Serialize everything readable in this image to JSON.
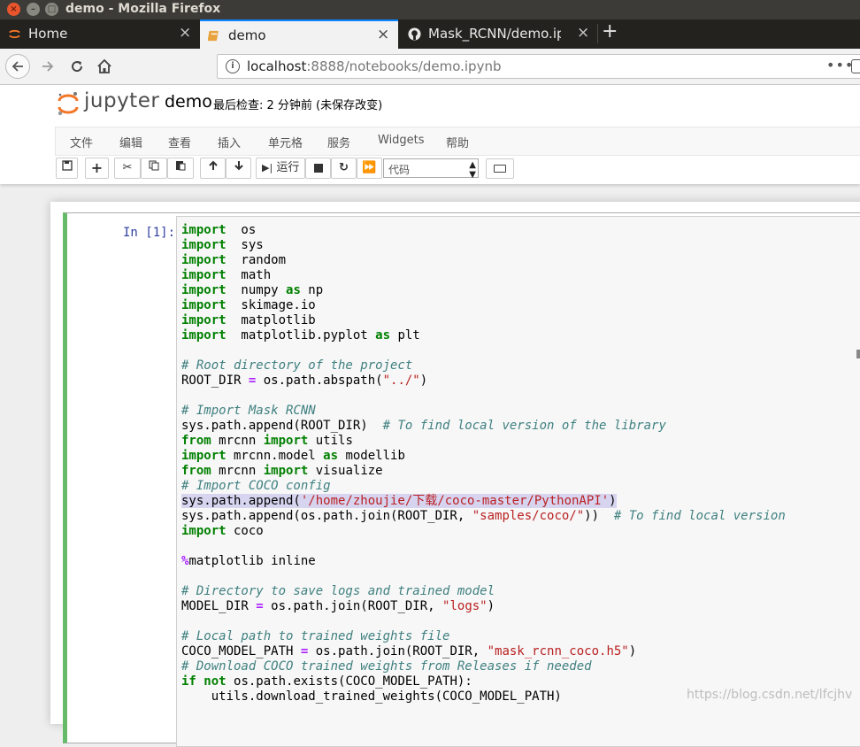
{
  "window": {
    "title": "demo - Mozilla Firefox"
  },
  "tabs": [
    {
      "label": "Home",
      "icon": "jupyter-icon"
    },
    {
      "label": "demo",
      "icon": "notebook-icon"
    },
    {
      "label": "Mask_RCNN/demo.ipynb",
      "icon": "github-icon"
    }
  ],
  "url": {
    "host": "localhost",
    "path": ":8888/notebooks/demo.ipynb",
    "more": "•••"
  },
  "jupyter": {
    "logo_text": "jupyter",
    "notebook_name": "demo",
    "checkpoint": "最后检查: 2 分钟前  (未保存改变)"
  },
  "menu": [
    "文件",
    "编辑",
    "查看",
    "插入",
    "单元格",
    "服务",
    "Widgets",
    "帮助"
  ],
  "toolbar": {
    "run_label": "运行",
    "cell_type": "代码"
  },
  "cell": {
    "prompt": "In [1]:",
    "lines": [
      [
        [
          "kw",
          "import"
        ],
        [
          "",
          "  os"
        ]
      ],
      [
        [
          "kw",
          "import"
        ],
        [
          "",
          "  sys"
        ]
      ],
      [
        [
          "kw",
          "import"
        ],
        [
          "",
          "  random"
        ]
      ],
      [
        [
          "kw",
          "import"
        ],
        [
          "",
          "  math"
        ]
      ],
      [
        [
          "kw",
          "import"
        ],
        [
          "",
          "  numpy "
        ],
        [
          "kw",
          "as"
        ],
        [
          "",
          " np"
        ]
      ],
      [
        [
          "kw",
          "import"
        ],
        [
          "",
          "  skimage.io"
        ]
      ],
      [
        [
          "kw",
          "import"
        ],
        [
          "",
          "  matplotlib"
        ]
      ],
      [
        [
          "kw",
          "import"
        ],
        [
          "",
          "  matplotlib.pyplot "
        ],
        [
          "kw",
          "as"
        ],
        [
          "",
          " plt"
        ]
      ],
      [],
      [
        [
          "cm",
          "# Root directory of the project"
        ]
      ],
      [
        [
          "",
          "ROOT_DIR "
        ],
        [
          "op",
          "="
        ],
        [
          "",
          " os.path.abspath("
        ],
        [
          "st",
          "\"../\""
        ],
        [
          "",
          ")"
        ]
      ],
      [],
      [
        [
          "cm",
          "# Import Mask RCNN"
        ]
      ],
      [
        [
          "",
          "sys.path.append(ROOT_DIR)  "
        ],
        [
          "cm",
          "# To find local version of the library"
        ]
      ],
      [
        [
          "kw",
          "from"
        ],
        [
          "",
          " mrcnn "
        ],
        [
          "kw",
          "import"
        ],
        [
          "",
          " utils"
        ]
      ],
      [
        [
          "kw",
          "import"
        ],
        [
          "",
          " mrcnn.model "
        ],
        [
          "kw",
          "as"
        ],
        [
          "",
          " modellib"
        ]
      ],
      [
        [
          "kw",
          "from"
        ],
        [
          "",
          " mrcnn "
        ],
        [
          "kw",
          "import"
        ],
        [
          "",
          " visualize"
        ]
      ],
      [
        [
          "cm",
          "# Import COCO config"
        ]
      ],
      [
        [
          "hl",
          "sys.path.append("
        ],
        [
          "hlst",
          "'/home/zhoujie/下载/coco-master/PythonAPI'"
        ],
        [
          "hl",
          ")"
        ]
      ],
      [
        [
          "",
          "sys.path.append(os.path.join(ROOT_DIR, "
        ],
        [
          "st",
          "\"samples/coco/\""
        ],
        [
          "",
          "))  "
        ],
        [
          "cm",
          "# To find local version"
        ]
      ],
      [
        [
          "kw",
          "import"
        ],
        [
          "",
          " coco"
        ]
      ],
      [],
      [
        [
          "op",
          "%"
        ],
        [
          "",
          "matplotlib inline"
        ]
      ],
      [],
      [
        [
          "cm",
          "# Directory to save logs and trained model"
        ]
      ],
      [
        [
          "",
          "MODEL_DIR "
        ],
        [
          "op",
          "="
        ],
        [
          "",
          " os.path.join(ROOT_DIR, "
        ],
        [
          "st",
          "\"logs\""
        ],
        [
          "",
          ")"
        ]
      ],
      [],
      [
        [
          "cm",
          "# Local path to trained weights file"
        ]
      ],
      [
        [
          "",
          "COCO_MODEL_PATH "
        ],
        [
          "op",
          "="
        ],
        [
          "",
          " os.path.join(ROOT_DIR, "
        ],
        [
          "st",
          "\"mask_rcnn_coco.h5\""
        ],
        [
          "",
          ")"
        ]
      ],
      [
        [
          "cm",
          "# Download COCO trained weights from Releases if needed"
        ]
      ],
      [
        [
          "kw",
          "if"
        ],
        [
          "",
          " "
        ],
        [
          "kw",
          "not"
        ],
        [
          "",
          " os.path.exists(COCO_MODEL_PATH):"
        ]
      ],
      [
        [
          "",
          "    utils.download_trained_weights(COCO_MODEL_PATH)"
        ]
      ]
    ]
  },
  "watermark": "https://blog.csdn.net/lfcjhv",
  "colors": {
    "cell_border_active": "#66bb6a",
    "prompt": "#303f9f",
    "keyword": "#008000",
    "comment": "#408080",
    "string": "#ba2121"
  }
}
